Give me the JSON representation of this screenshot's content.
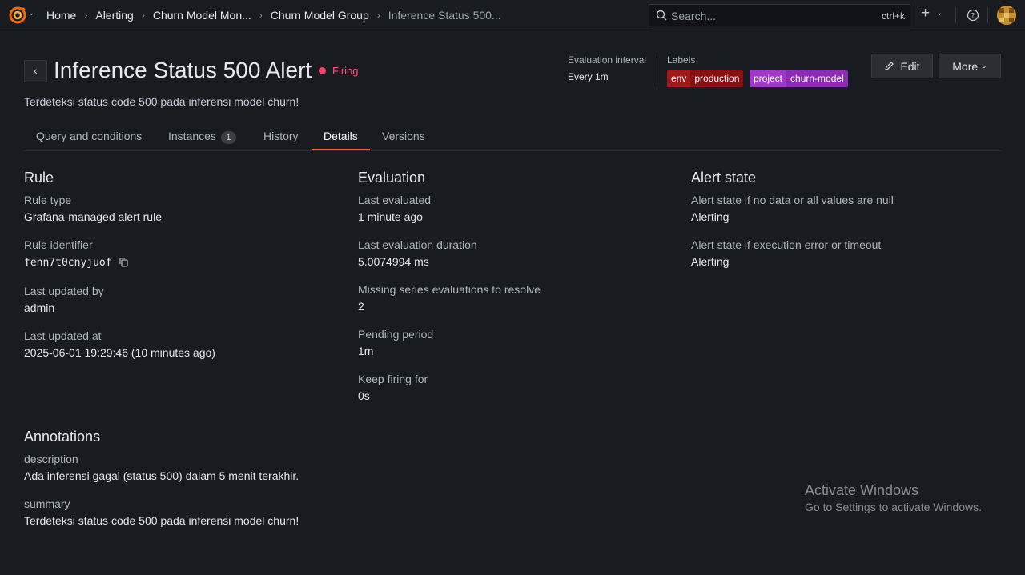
{
  "breadcrumbs": [
    "Home",
    "Alerting",
    "Churn Model Mon...",
    "Churn Model Group",
    "Inference Status 500..."
  ],
  "search": {
    "placeholder": "Search...",
    "shortcut": "ctrl+k"
  },
  "header": {
    "title": "Inference Status 500 Alert",
    "state": "Firing",
    "subtitle": "Terdeteksi status code 500 pada inferensi model churn!",
    "evaluation_interval_label": "Evaluation interval",
    "evaluation_interval_value": "Every 1m",
    "labels_label": "Labels",
    "labels": [
      {
        "key": "env",
        "value": "production",
        "color": "#a3171b"
      },
      {
        "key": "project",
        "value": "churn-model",
        "color": "#a138c9"
      }
    ],
    "edit_label": "Edit",
    "more_label": "More"
  },
  "tabs": [
    {
      "label": "Query and conditions"
    },
    {
      "label": "Instances",
      "badge": "1"
    },
    {
      "label": "History"
    },
    {
      "label": "Details",
      "active": true
    },
    {
      "label": "Versions"
    }
  ],
  "rule": {
    "title": "Rule",
    "fields": [
      {
        "label": "Rule type",
        "value": "Grafana-managed alert rule"
      },
      {
        "label": "Rule identifier",
        "value": "fenn7t0cnyjuof"
      },
      {
        "label": "Last updated by",
        "value": "admin"
      },
      {
        "label": "Last updated at",
        "value": "2025-06-01 19:29:46 (10 minutes ago)"
      }
    ]
  },
  "evaluation": {
    "title": "Evaluation",
    "fields": [
      {
        "label": "Last evaluated",
        "value": "1 minute ago"
      },
      {
        "label": "Last evaluation duration",
        "value": "5.0074994 ms"
      },
      {
        "label": "Missing series evaluations to resolve",
        "value": "2"
      },
      {
        "label": "Pending period",
        "value": "1m"
      },
      {
        "label": "Keep firing for",
        "value": "0s"
      }
    ]
  },
  "alert_state": {
    "title": "Alert state",
    "fields": [
      {
        "label": "Alert state if no data or all values are null",
        "value": "Alerting"
      },
      {
        "label": "Alert state if execution error or timeout",
        "value": "Alerting"
      }
    ]
  },
  "annotations": {
    "title": "Annotations",
    "fields": [
      {
        "label": "description",
        "value": "Ada inferensi gagal (status 500) dalam 5 menit terakhir."
      },
      {
        "label": "summary",
        "value": "Terdeteksi status code 500 pada inferensi model churn!"
      }
    ]
  },
  "watermark": {
    "line1": "Activate Windows",
    "line2": "Go to Settings to activate Windows."
  },
  "colors": {
    "accent_tab": "#f55f3e",
    "firing": "#ff5286",
    "background": "#181b1f"
  }
}
